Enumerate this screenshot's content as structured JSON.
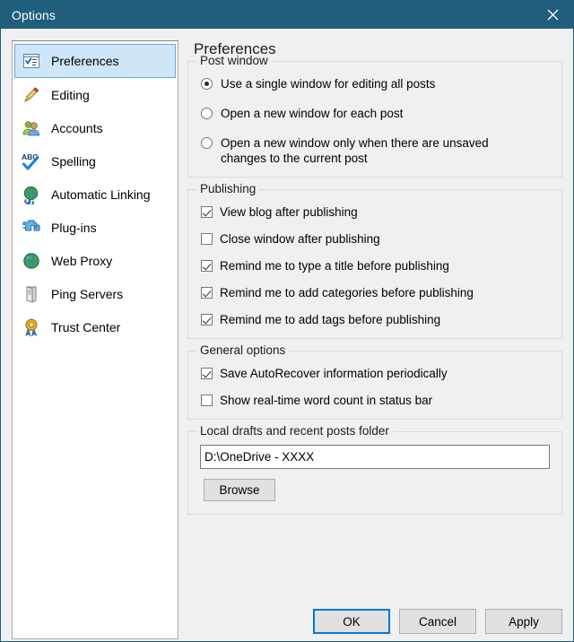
{
  "window": {
    "title": "Options",
    "close_icon": "close-icon",
    "titlebar_color": "#215E7C",
    "accent_color": "#0078D7"
  },
  "sidebar": {
    "items": [
      {
        "label": "Preferences",
        "icon": "checklist-icon",
        "selected": true
      },
      {
        "label": "Editing",
        "icon": "pencil-icon",
        "selected": false
      },
      {
        "label": "Accounts",
        "icon": "users-icon",
        "selected": false
      },
      {
        "label": "Spelling",
        "icon": "abc-check-icon",
        "selected": false
      },
      {
        "label": "Automatic Linking",
        "icon": "globe-link-icon",
        "selected": false
      },
      {
        "label": "Plug-ins",
        "icon": "puzzle-icon",
        "selected": false
      },
      {
        "label": "Web Proxy",
        "icon": "globe-icon",
        "selected": false
      },
      {
        "label": "Ping Servers",
        "icon": "server-icon",
        "selected": false
      },
      {
        "label": "Trust Center",
        "icon": "ribbon-icon",
        "selected": false
      }
    ]
  },
  "pane": {
    "title": "Preferences",
    "post_window": {
      "title": "Post window",
      "options": [
        {
          "label": "Use a single window for editing all posts",
          "selected": true
        },
        {
          "label": "Open a new window for each post",
          "selected": false
        },
        {
          "label": "Open a new window only when there are unsaved changes to the current post",
          "selected": false
        }
      ]
    },
    "publishing": {
      "title": "Publishing",
      "options": [
        {
          "label": "View blog after publishing",
          "checked": true
        },
        {
          "label": "Close window after publishing",
          "checked": false
        },
        {
          "label": "Remind me to type a title before publishing",
          "checked": true
        },
        {
          "label": "Remind me to add categories before publishing",
          "checked": true
        },
        {
          "label": "Remind me to add tags before publishing",
          "checked": true
        }
      ]
    },
    "general_options": {
      "title": "General options",
      "options": [
        {
          "label": "Save AutoRecover information periodically",
          "checked": true
        },
        {
          "label": "Show real-time word count in status bar",
          "checked": false
        }
      ]
    },
    "local_drafts": {
      "title": "Local drafts and recent posts folder",
      "folder_value": "D:\\OneDrive - XXXX",
      "folder_placeholder": "",
      "browse_label": "Browse"
    }
  },
  "footer": {
    "ok_label": "OK",
    "cancel_label": "Cancel",
    "apply_label": "Apply"
  }
}
